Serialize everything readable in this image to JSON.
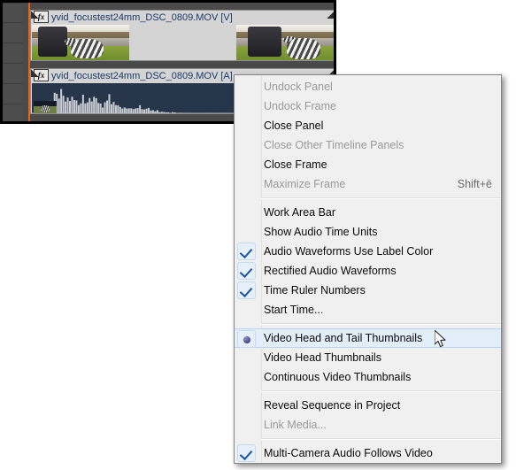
{
  "timeline": {
    "video_clip": {
      "fx_badge": "fx",
      "name": "yvid_focustest24mm_DSC_0809.MOV [V]",
      "head_thumbnail": "dog-on-path-thumbnail",
      "tail_thumbnail": "dog-on-path-thumbnail"
    },
    "audio_clip": {
      "fx_badge": "fx",
      "name": "yvid_focustest24mm_DSC_0809.MOV [A]",
      "waveform": "audio-waveform"
    },
    "playhead_color": "#e8631a",
    "clip_label_color": "#d4d4d4",
    "waveform_bg_color": "#27354b",
    "waveform_color": "#c9cdd2"
  },
  "context_menu": {
    "groups": [
      {
        "items": [
          {
            "label": "Undock Panel",
            "state": "disabled",
            "mark": "none",
            "shortcut": ""
          },
          {
            "label": "Undock Frame",
            "state": "disabled",
            "mark": "none",
            "shortcut": ""
          },
          {
            "label": "Close Panel",
            "state": "enabled",
            "mark": "none",
            "shortcut": ""
          },
          {
            "label": "Close Other Timeline Panels",
            "state": "disabled",
            "mark": "none",
            "shortcut": ""
          },
          {
            "label": "Close Frame",
            "state": "enabled",
            "mark": "none",
            "shortcut": ""
          },
          {
            "label": "Maximize Frame",
            "state": "disabled",
            "mark": "none",
            "shortcut": "Shift+ë"
          }
        ]
      },
      {
        "items": [
          {
            "label": "Work Area Bar",
            "state": "enabled",
            "mark": "none",
            "shortcut": ""
          },
          {
            "label": "Show Audio Time Units",
            "state": "enabled",
            "mark": "none",
            "shortcut": ""
          },
          {
            "label": "Audio Waveforms Use Label Color",
            "state": "enabled",
            "mark": "check",
            "shortcut": ""
          },
          {
            "label": "Rectified Audio Waveforms",
            "state": "enabled",
            "mark": "check",
            "shortcut": ""
          },
          {
            "label": "Time Ruler Numbers",
            "state": "enabled",
            "mark": "check",
            "shortcut": ""
          },
          {
            "label": "Start Time...",
            "state": "enabled",
            "mark": "none",
            "shortcut": ""
          }
        ]
      },
      {
        "items": [
          {
            "label": "Video Head and Tail Thumbnails",
            "state": "selected",
            "mark": "radio",
            "shortcut": ""
          },
          {
            "label": "Video Head Thumbnails",
            "state": "enabled",
            "mark": "none",
            "shortcut": ""
          },
          {
            "label": "Continuous Video Thumbnails",
            "state": "enabled",
            "mark": "none",
            "shortcut": ""
          }
        ]
      },
      {
        "items": [
          {
            "label": "Reveal Sequence in Project",
            "state": "enabled",
            "mark": "none",
            "shortcut": ""
          },
          {
            "label": "Link Media...",
            "state": "disabled",
            "mark": "none",
            "shortcut": ""
          }
        ]
      },
      {
        "items": [
          {
            "label": "Multi-Camera Audio Follows Video",
            "state": "enabled",
            "mark": "check",
            "shortcut": ""
          }
        ]
      }
    ],
    "highlight_color": "#e3eefb",
    "background_color": "#f0f0f0"
  },
  "cursor": {
    "type": "arrow-pointer"
  }
}
